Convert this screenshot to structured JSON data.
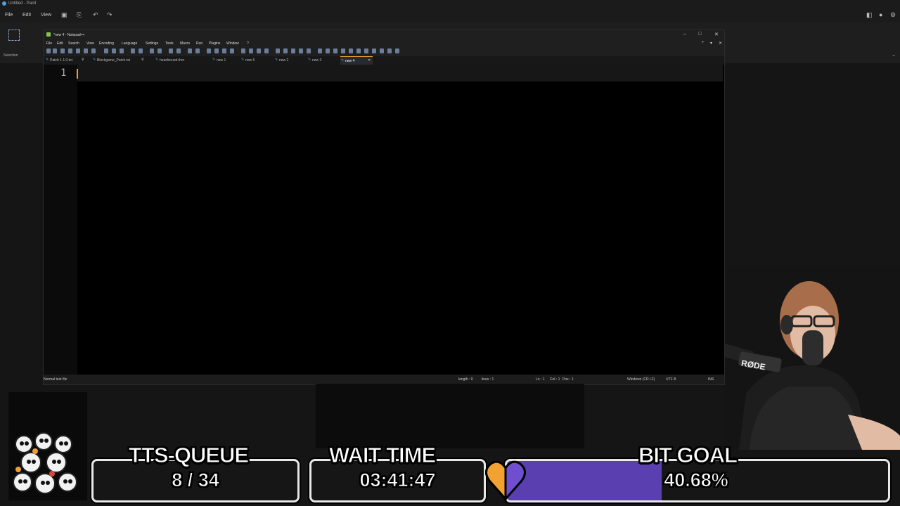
{
  "paint": {
    "title": "Untitled - Paint",
    "menu": [
      "File",
      "Edit",
      "View"
    ],
    "selection_label": "Selection"
  },
  "npp": {
    "title": "*new 4 - Notepad++",
    "menu": [
      "File",
      "Edit",
      "Search",
      "View",
      "Encoding",
      "Language",
      "Settings",
      "Tools",
      "Macro",
      "Run",
      "Plugins",
      "Window",
      "?"
    ],
    "tabs": [
      {
        "label": "Patch 1.1.0.txt",
        "active": false
      },
      {
        "label": "Blockgame_Patch.txt",
        "active": false
      },
      {
        "label": "heartbound.thor",
        "active": false
      },
      {
        "label": "new 1",
        "active": false
      },
      {
        "label": "new 5",
        "active": false
      },
      {
        "label": "new 2",
        "active": false
      },
      {
        "label": "new 3",
        "active": false
      },
      {
        "label": "new 4",
        "active": true
      }
    ],
    "line_number": "1",
    "status": {
      "file_type": "Normal text file",
      "length": "length : 0",
      "lines": "lines : 1",
      "ln": "Ln : 1",
      "col": "Col : 1",
      "pos": "Pos : 1",
      "eol": "Windows (CR LF)",
      "encoding": "UTF-8",
      "mode": "INS"
    }
  },
  "overlay": {
    "tts": {
      "title": "TTS-QUEUE",
      "value": "8 / 34"
    },
    "wait": {
      "title": "WAIT TIME",
      "value": "03:41:47"
    },
    "bit": {
      "title": "BIT GOAL",
      "value": "40.68%",
      "fraction": 0.4068
    }
  },
  "webcam": {
    "mic_brand": "RØDE"
  },
  "colors": {
    "accent": "#f0a030",
    "bit_fill": "#5a3fb0",
    "overlay_border": "#e8e8e8"
  }
}
